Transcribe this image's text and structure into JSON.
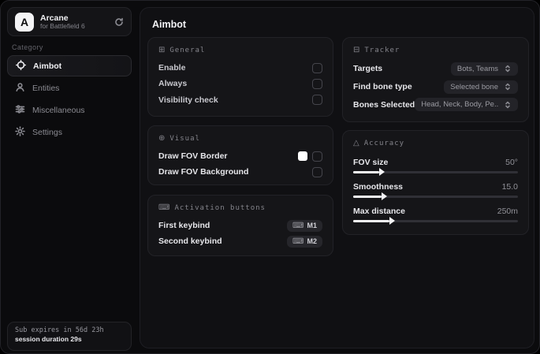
{
  "app": {
    "logo_letter": "A",
    "name": "Arcane",
    "subtitle": "for Battlefield 6"
  },
  "sidebar": {
    "category_label": "Category",
    "items": [
      {
        "label": "Aimbot"
      },
      {
        "label": "Entities"
      },
      {
        "label": "Miscellaneous"
      },
      {
        "label": "Settings"
      }
    ],
    "footer": {
      "line1": "Sub expires in 56d 23h",
      "line2": "session duration 29s"
    }
  },
  "main": {
    "title": "Aimbot",
    "general": {
      "header": "General",
      "rows": [
        {
          "label": "Enable",
          "checked": false
        },
        {
          "label": "Always",
          "checked": false
        },
        {
          "label": "Visibility check",
          "checked": false
        }
      ]
    },
    "visual": {
      "header": "Visual",
      "rows": [
        {
          "label": "Draw FOV Border",
          "swatch": "#ffffff",
          "checked": false
        },
        {
          "label": "Draw FOV Background",
          "checked": false
        }
      ]
    },
    "activation": {
      "header": "Activation buttons",
      "rows": [
        {
          "label": "First keybind",
          "key": "M1"
        },
        {
          "label": "Second keybind",
          "key": "M2"
        }
      ]
    },
    "tracker": {
      "header": "Tracker",
      "rows": [
        {
          "label": "Targets",
          "value": "Bots, Teams"
        },
        {
          "label": "Find bone type",
          "value": "Selected bone"
        },
        {
          "label": "Bones Selected",
          "value": "Head, Neck, Body, Pe.."
        }
      ]
    },
    "accuracy": {
      "header": "Accuracy",
      "sliders": [
        {
          "label": "FOV size",
          "value": "50°",
          "fill_pct": 16
        },
        {
          "label": "Smoothness",
          "value": "15.0",
          "fill_pct": 17
        },
        {
          "label": "Max distance",
          "value": "250m",
          "fill_pct": 22
        }
      ]
    }
  },
  "icons": {
    "general_glyph": "⊞",
    "visual_glyph": "⊕",
    "activation_glyph": "⌨",
    "tracker_glyph": "⊟",
    "accuracy_glyph": "△",
    "keyboard_glyph": "⌨"
  },
  "colors": {
    "accent": "#ffffff",
    "fov_border_swatch": "#ffffff"
  }
}
